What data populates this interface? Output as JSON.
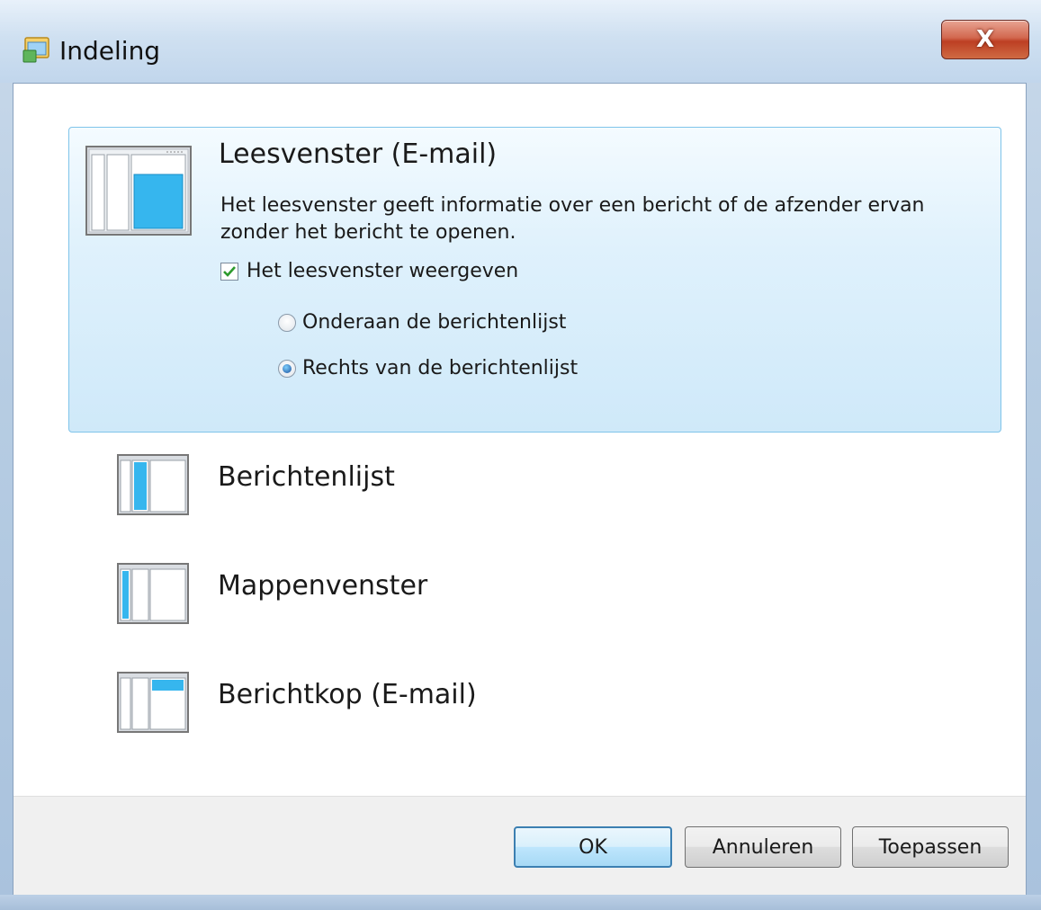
{
  "window": {
    "title": "Indeling",
    "close_label": "X"
  },
  "selected_panel": {
    "title": "Leesvenster (E-mail)",
    "description": "Het leesvenster geeft informatie over een bericht of de afzender ervan zonder het bericht te openen.",
    "checkbox_label": "Het leesvenster weergeven",
    "checkbox_checked": true,
    "radio_options": [
      {
        "label": "Onderaan de berichtenlijst",
        "selected": false
      },
      {
        "label": "Rechts van de berichtenlijst",
        "selected": true
      }
    ]
  },
  "items": [
    {
      "label": "Berichtenlijst",
      "icon": "message-list-icon"
    },
    {
      "label": "Mappenvenster",
      "icon": "folder-pane-icon"
    },
    {
      "label": "Berichtkop (E-mail)",
      "icon": "message-header-icon"
    }
  ],
  "buttons": {
    "ok": "OK",
    "cancel": "Annuleren",
    "apply": "Toepassen"
  },
  "colors": {
    "selection_border": "#7fc4ea",
    "selection_fill": "#dff1fc",
    "accent": "#3c7fb1",
    "close_red": "#bd3f23"
  }
}
